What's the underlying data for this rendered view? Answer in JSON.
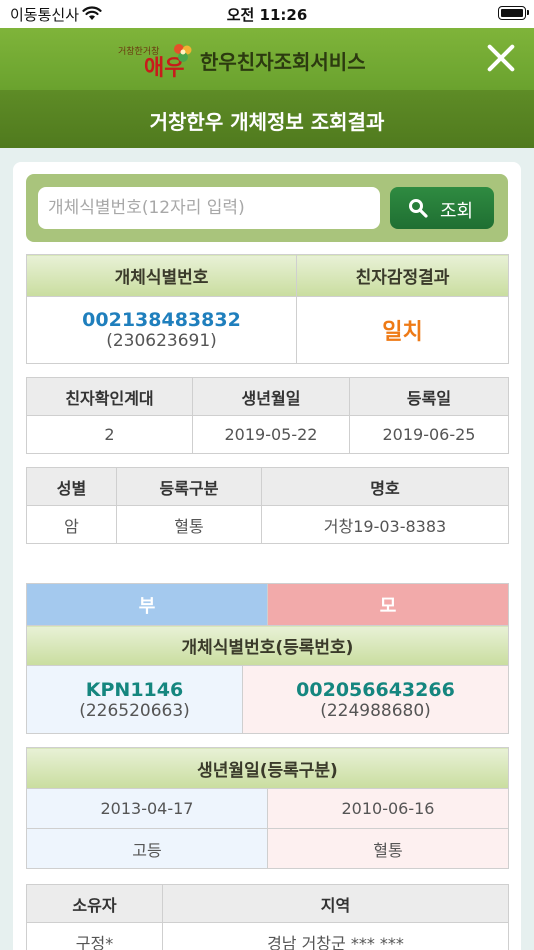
{
  "status_bar": {
    "carrier": "이동통신사",
    "time": "오전 11:26"
  },
  "header": {
    "logo_small": "거창한거창",
    "logo_big": "애우",
    "title": "한우친자조회서비스",
    "subtitle": "거창한우 개체정보 조회결과"
  },
  "search": {
    "placeholder": "개체식별번호(12자리 입력)",
    "value": "",
    "button_label": "조회"
  },
  "result": {
    "id_header": "개체식별번호",
    "result_header": "친자감정결과",
    "id_number": "002138483832",
    "id_sub": "(230623691)",
    "result_value": "일치"
  },
  "info1": {
    "headers": [
      "친자확인계대",
      "생년월일",
      "등록일"
    ],
    "values": [
      "2",
      "2019-05-22",
      "2019-06-25"
    ]
  },
  "info2": {
    "headers": [
      "성별",
      "등록구분",
      "명호"
    ],
    "values": [
      "암",
      "혈통",
      "거창19-03-8383"
    ]
  },
  "parents": {
    "father_label": "부",
    "mother_label": "모",
    "id_header": "개체식별번호(등록번호)",
    "father_id": "KPN1146",
    "father_sub": "(226520663)",
    "mother_id": "002056643266",
    "mother_sub": "(224988680)",
    "birth_header": "생년월일(등록구분)",
    "father_birth": "2013-04-17",
    "mother_birth": "2010-06-16",
    "father_type": "고등",
    "mother_type": "혈통"
  },
  "owner": {
    "headers": [
      "소유자",
      "지역"
    ],
    "values": [
      "구정*",
      "경남 거창군 *** ***"
    ]
  },
  "colors": {
    "topbar": "#7fb43a",
    "subbar": "#5e8c26",
    "search_button": "#2f8b41",
    "id_blue": "#1f7fbd",
    "id_teal": "#15867f",
    "result_orange": "#ee7a16",
    "father_blue": "#a4c9ee",
    "mother_pink": "#f2aaaa"
  },
  "icons": [
    "wifi-icon",
    "battery-icon",
    "logo-flower-icon",
    "close-icon",
    "search-icon"
  ]
}
